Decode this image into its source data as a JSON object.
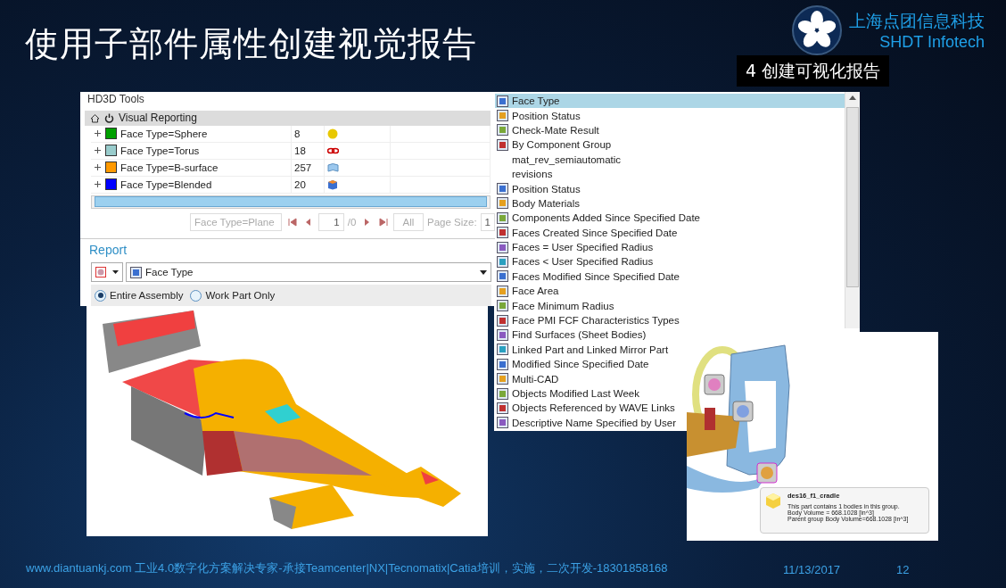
{
  "slide": {
    "title": "使用子部件属性创建视觉报告",
    "step_badge": "4 创建可视化报告"
  },
  "logo": {
    "name_cn": "上海点团信息科技",
    "name_en": "SHDT Infotech"
  },
  "hd3d_panel": {
    "title": "HD3D Tools",
    "section": "Visual Reporting",
    "rows": [
      {
        "label": "Face Type=Sphere",
        "count": "8",
        "color": "#00a000",
        "kind": "sphere"
      },
      {
        "label": "Face Type=Torus",
        "count": "18",
        "color": "#99cccc",
        "kind": "torus"
      },
      {
        "label": "Face Type=B-surface",
        "count": "257",
        "color": "#ff9900",
        "kind": "bsurface"
      },
      {
        "label": "Face Type=Blended",
        "count": "20",
        "color": "#0000ff",
        "kind": "blended"
      }
    ],
    "pager": {
      "filter": "Face Type=Plane",
      "page": "1",
      "of": "/0",
      "all": "All",
      "page_size_label": "Page Size:",
      "page_size": "1"
    }
  },
  "report": {
    "title": "Report",
    "report_type": "Face Type",
    "scopes": [
      {
        "label": "Entire Assembly",
        "selected": true
      },
      {
        "label": "Work Part Only",
        "selected": false
      }
    ]
  },
  "report_list": {
    "items": [
      {
        "label": "Face Type",
        "selected": true,
        "kind": "icon"
      },
      {
        "label": "Position Status",
        "selected": false,
        "kind": "icon"
      },
      {
        "label": "Check-Mate Result",
        "selected": false,
        "kind": "icon"
      },
      {
        "label": "By Component Group",
        "selected": false,
        "kind": "icon"
      },
      {
        "label": "mat_rev_semiautomatic",
        "selected": false,
        "kind": "text"
      },
      {
        "label": "revisions",
        "selected": false,
        "kind": "text"
      },
      {
        "label": "Position Status",
        "selected": false,
        "kind": "icon"
      },
      {
        "label": "Body Materials",
        "selected": false,
        "kind": "icon"
      },
      {
        "label": "Components Added Since Specified Date",
        "selected": false,
        "kind": "icon"
      },
      {
        "label": "Faces Created Since Specified Date",
        "selected": false,
        "kind": "icon"
      },
      {
        "label": "Faces = User Specified Radius",
        "selected": false,
        "kind": "icon"
      },
      {
        "label": "Faces < User Specified Radius",
        "selected": false,
        "kind": "icon"
      },
      {
        "label": "Faces Modified Since Specified Date",
        "selected": false,
        "kind": "icon"
      },
      {
        "label": "Face Area",
        "selected": false,
        "kind": "icon"
      },
      {
        "label": "Face Minimum Radius",
        "selected": false,
        "kind": "icon"
      },
      {
        "label": "Face PMI FCF Characteristics Types",
        "selected": false,
        "kind": "icon"
      },
      {
        "label": "Find Surfaces (Sheet Bodies)",
        "selected": false,
        "kind": "icon"
      },
      {
        "label": "Linked Part and Linked Mirror Part",
        "selected": false,
        "kind": "icon"
      },
      {
        "label": "Modified Since Specified Date",
        "selected": false,
        "kind": "icon"
      },
      {
        "label": "Multi-CAD",
        "selected": false,
        "kind": "icon"
      },
      {
        "label": "Objects Modified Last Week",
        "selected": false,
        "kind": "icon"
      },
      {
        "label": "Objects Referenced by WAVE Links",
        "selected": false,
        "kind": "icon"
      },
      {
        "label": "Descriptive Name Specified by User",
        "selected": false,
        "kind": "icon"
      }
    ]
  },
  "tooltip": {
    "title": "des16_f1_cradle",
    "lines": [
      "This part contains 1 bodies in this group.",
      "Body Volume = 668.1028 [in^3]",
      "Parent group Body Volume=668.1028 [in^3]"
    ]
  },
  "footer": {
    "text": "www.diantuankj.com 工业4.0数字化方案解决专家-承接Teamcenter|NX|Tecnomatix|Catia培训，实施，二次开发-18301858168",
    "date": "11/13/2017",
    "page": "12"
  }
}
